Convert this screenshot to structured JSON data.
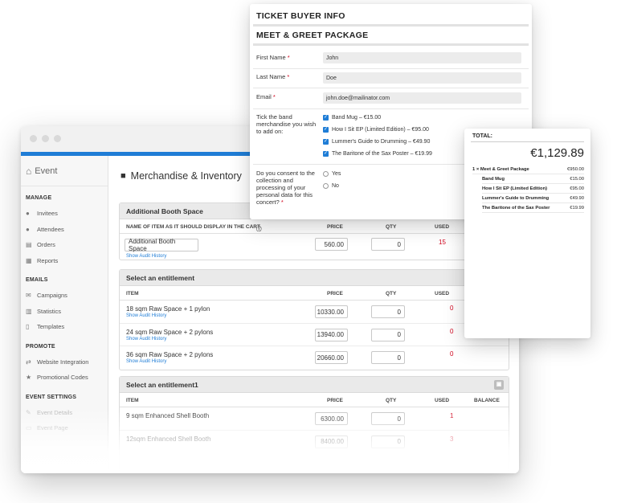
{
  "sidebar": {
    "event_label": "Event",
    "sections": [
      {
        "title": "MANAGE",
        "items": [
          {
            "label": "Invitees",
            "icon": "user-icon"
          },
          {
            "label": "Attendees",
            "icon": "user-icon"
          },
          {
            "label": "Orders",
            "icon": "list-icon"
          },
          {
            "label": "Reports",
            "icon": "table-icon"
          }
        ]
      },
      {
        "title": "EMAILS",
        "items": [
          {
            "label": "Campaigns",
            "icon": "envelope-icon"
          },
          {
            "label": "Statistics",
            "icon": "chart-icon"
          },
          {
            "label": "Templates",
            "icon": "file-icon"
          }
        ]
      },
      {
        "title": "PROMOTE",
        "items": [
          {
            "label": "Website Integration",
            "icon": "arrows-icon"
          },
          {
            "label": "Promotional Codes",
            "icon": "star-icon"
          }
        ]
      },
      {
        "title": "EVENT SETTINGS",
        "items": [
          {
            "label": "Event Details",
            "icon": "pencil-icon"
          },
          {
            "label": "Event Page",
            "icon": "monitor-icon"
          }
        ]
      }
    ]
  },
  "page": {
    "title": "Merchandise & Inventory"
  },
  "panels": [
    {
      "title": "Additional Booth Space",
      "columns": {
        "item": "NAME OF ITEM AS IT SHOULD DISPLAY IN THE CART",
        "price": "PRICE",
        "qty": "QTY",
        "used": "USED"
      },
      "rows": [
        {
          "name": "Additional Booth Space",
          "audit": "Show Audit History",
          "price": "560.00",
          "qty": "0",
          "used": "15"
        }
      ]
    },
    {
      "title": "Select an entitlement",
      "columns": {
        "item": "ITEM",
        "price": "PRICE",
        "qty": "QTY",
        "used": "USED"
      },
      "rows": [
        {
          "name": "18 sqm Raw Space + 1 pylon",
          "audit": "Show Audit History",
          "price": "10330.00",
          "qty": "0",
          "used": "0"
        },
        {
          "name": "24 sqm Raw Space + 2 pylons",
          "audit": "Show Audit History",
          "price": "13940.00",
          "qty": "0",
          "used": "0"
        },
        {
          "name": "36 sqm Raw Space + 2 pylons",
          "audit": "Show Audit History",
          "price": "20660.00",
          "qty": "0",
          "used": "0"
        }
      ]
    },
    {
      "title": "Select an entitlement1",
      "columns": {
        "item": "ITEM",
        "price": "PRICE",
        "qty": "QTY",
        "used": "USED",
        "balance": "BALANCE"
      },
      "rows": [
        {
          "name": "9 sqm Enhanced Shell Booth",
          "price": "6300.00",
          "qty": "0",
          "used": "1"
        },
        {
          "name": "12sqm Enhanced Shell Booth",
          "price": "8400.00",
          "qty": "0",
          "used": "3"
        }
      ]
    }
  ],
  "form": {
    "title": "TICKET BUYER INFO",
    "subtitle": "MEET & GREET PACKAGE",
    "fields": [
      {
        "label": "First Name",
        "value": "John"
      },
      {
        "label": "Last Name",
        "value": "Doe"
      },
      {
        "label": "Email",
        "value": "john.doe@mailinator.com"
      }
    ],
    "required_mark": "*",
    "merch_question": "Tick the band merchandise you wish to add on:",
    "merch_options": [
      "Band Mug – €15.00",
      "How I Sit EP (Limited Edition) – €95.00",
      "Lummer's Guide to Drumming – €49.90",
      "The Baritone of the Sax Poster – €19.99"
    ],
    "consent_question": "Do you consent to the collection and processing of your personal data for this concert?",
    "consent_options": [
      "Yes",
      "No"
    ]
  },
  "total": {
    "label": "TOTAL:",
    "amount": "€1,129.89",
    "lines": [
      {
        "name": "1 × Meet & Greet Package",
        "amount": "€950.00",
        "sub": false
      },
      {
        "name": "Band Mug",
        "amount": "€15.00",
        "sub": true
      },
      {
        "name": "How I Sit EP (Limited Edition)",
        "amount": "€95.00",
        "sub": true
      },
      {
        "name": "Lummer's Guide to Drumming",
        "amount": "€49.90",
        "sub": true
      },
      {
        "name": "The Baritone of the Sax Poster",
        "amount": "€19.99",
        "sub": true
      }
    ]
  },
  "colors": {
    "accent": "#1f7dd6",
    "danger": "#d0021b"
  }
}
